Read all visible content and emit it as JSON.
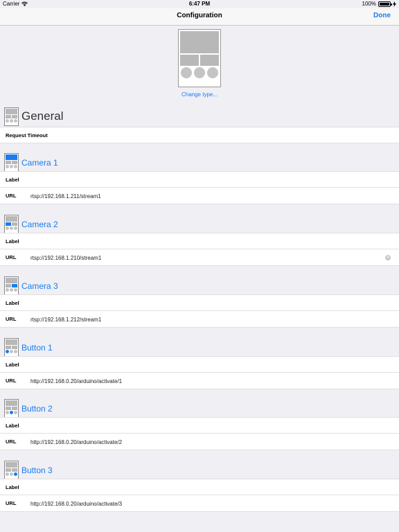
{
  "status": {
    "carrier": "Carrier",
    "time": "6:47 PM",
    "battery": "100%"
  },
  "nav": {
    "title": "Configuration",
    "done": "Done"
  },
  "preview": {
    "change_type": "Change type..."
  },
  "general": {
    "title": "General",
    "request_timeout_label": "Request Timeout"
  },
  "sections": [
    {
      "title": "Camera 1",
      "label_label": "Label",
      "url_label": "URL",
      "url": "rtsp://192.168.1.211/stream1"
    },
    {
      "title": "Camera 2",
      "label_label": "Label",
      "url_label": "URL",
      "url": "rtsp://192.168.1.210/stream1"
    },
    {
      "title": "Camera 3",
      "label_label": "Label",
      "url_label": "URL",
      "url": "rtsp://192.168.1.212/stream1"
    },
    {
      "title": "Button 1",
      "label_label": "Label",
      "url_label": "URL",
      "url": "http://192.168.0.20/arduino/activate/1"
    },
    {
      "title": "Button 2",
      "label_label": "Label",
      "url_label": "URL",
      "url": "http://192.168.0.20/arduino/activate/2"
    },
    {
      "title": "Button 3",
      "label_label": "Label",
      "url_label": "URL",
      "url": "http://192.168.0.20/arduino/activate/3"
    }
  ],
  "colors": {
    "accent": "#1a7cf0",
    "background": "#efeff4"
  }
}
